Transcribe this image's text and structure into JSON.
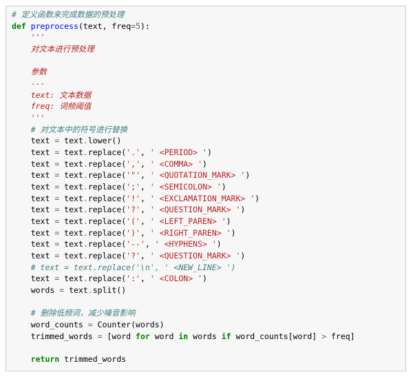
{
  "code": {
    "l01a": "# 定义函数来完成数据的预处理",
    "l02_kw": "def",
    "l02_fn": " preprocess",
    "l02_sig1": "(text, freq",
    "l02_op": "=",
    "l02_num": "5",
    "l02_sig2": "):",
    "l03": "    '''",
    "l04": "    对文本进行预处理",
    "l05": "    ",
    "l06": "    参数",
    "l07": "    ---",
    "l08": "    text: 文本数据",
    "l09": "    freq: 词频阈值",
    "l10": "    '''",
    "l11a": "    ",
    "l11b": "# 对文本中的符号进行替换",
    "l12a": "    text ",
    "l12op": "=",
    "l12b": " text",
    "l12dot": ".",
    "l12c": "lower()",
    "l13a": "    text ",
    "l13op": "=",
    "l13b": " text",
    "l13dot": ".",
    "l13c": "replace(",
    "l13s1": "'.'",
    "l13m": ", ",
    "l13s2": "' <PERIOD> '",
    "l13e": ")",
    "l14s1": "','",
    "l14s2": "' <COMMA> '",
    "l15s1": "'\"'",
    "l15s2": "' <QUOTATION_MARK> '",
    "l16s1": "';'",
    "l16s2": "' <SEMICOLON> '",
    "l17s1": "'!'",
    "l17s2": "' <EXCLAMATION_MARK> '",
    "l18s1": "'?'",
    "l18s2": "' <QUESTION_MARK> '",
    "l19s1": "'('",
    "l19s2": "' <LEFT_PAREN> '",
    "l20s1": "')'",
    "l20s2": "' <RIGHT_PAREN> '",
    "l21s1": "'--'",
    "l21s2": "' <HYPHENS> '",
    "l22s1": "'?'",
    "l22s2": "' <QUESTION_MARK> '",
    "l23": "    # text = text.replace('\\n', ' <NEW_LINE> ')",
    "l24s1": "':'",
    "l24s2": "' <COLON> '",
    "l25a": "    words ",
    "l25op": "=",
    "l25b": " text",
    "l25dot": ".",
    "l25c": "split()",
    "l26": "    ",
    "l27a": "    ",
    "l27b": "# 删除低频词，减少噪音影响",
    "l28a": "    word_counts ",
    "l28op": "=",
    "l28b": " Counter(words)",
    "l29a": "    trimmed_words ",
    "l29op": "=",
    "l29b": " [word ",
    "l29for": "for",
    "l29c": " word ",
    "l29in": "in",
    "l29d": " words ",
    "l29if": "if",
    "l29e": " word_counts[word] ",
    "l29gt": ">",
    "l29f": " freq]",
    "l30": "    ",
    "l31a": "    ",
    "l31kw": "return",
    "l31b": " trimmed_words"
  }
}
